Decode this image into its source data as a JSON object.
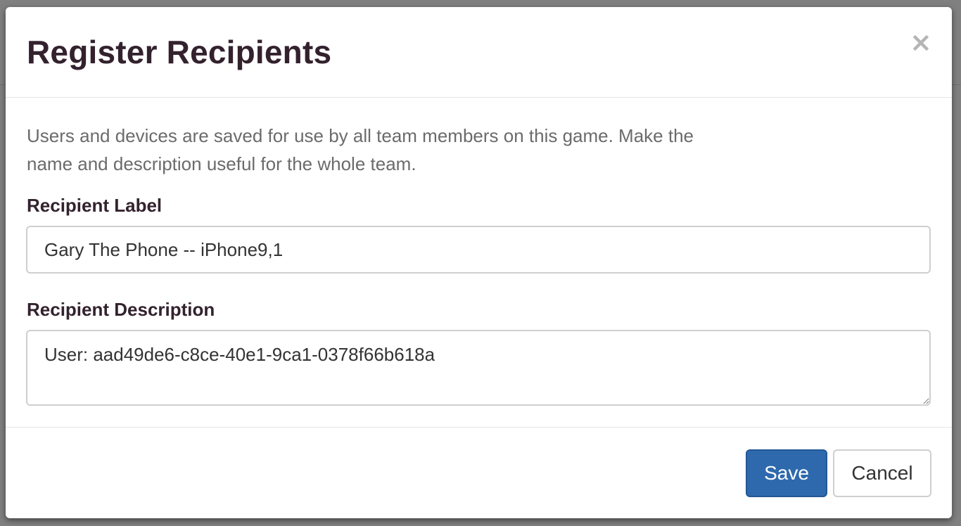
{
  "modal": {
    "title": "Register Recipients",
    "close_symbol": "×",
    "close_icon": "close-icon",
    "help_text": "Users and devices are saved for use by all team members on this game. Make the name and description useful for the whole team.",
    "fields": {
      "label": {
        "label": "Recipient Label",
        "value": "Gary The Phone -- iPhone9,1"
      },
      "description": {
        "label": "Recipient Description",
        "value": "User: aad49de6-c8ce-40e1-9ca1-0378f66b618a"
      }
    },
    "buttons": {
      "save": "Save",
      "cancel": "Cancel"
    }
  },
  "colors": {
    "backdrop": "#808080",
    "title_text": "#33222e",
    "help_text": "#6b6b6b",
    "primary_button": "#2e69ad",
    "border": "#cfcfcf"
  }
}
